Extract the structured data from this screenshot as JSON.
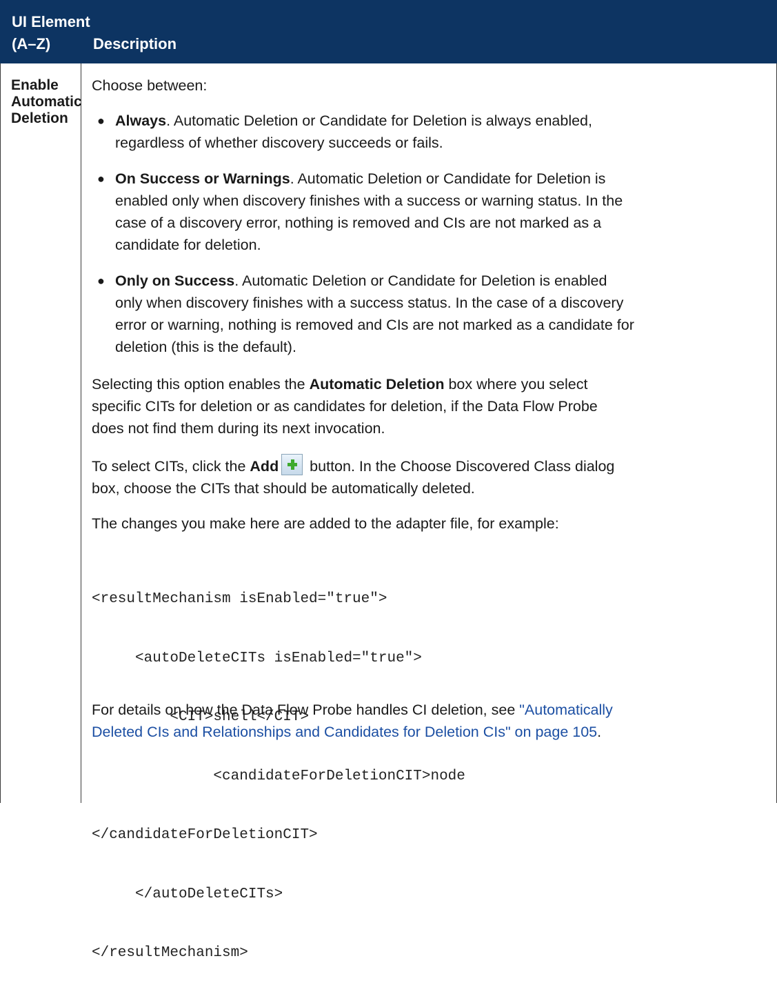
{
  "header": {
    "col1_line1": "UI Element",
    "col1_line2": "(A–Z)",
    "col2": "Description"
  },
  "row": {
    "ui_element_lines": [
      "Enable",
      "Automatic",
      "Deletion"
    ],
    "intro": "Choose between:",
    "bullets": [
      {
        "bold": "Always",
        "lines": [
          ". Automatic Deletion or Candidate for Deletion is always enabled,",
          "regardless of whether discovery succeeds or fails."
        ]
      },
      {
        "bold": "On Success or Warnings",
        "lines": [
          ". Automatic Deletion or Candidate for Deletion is",
          "enabled only when discovery finishes with a success or warning status. In the",
          "case of a discovery error, nothing is removed and CIs are not marked as a",
          "candidate for deletion."
        ]
      },
      {
        "bold": "Only on Success",
        "lines": [
          ". Automatic Deletion or Candidate for Deletion is enabled",
          "only when discovery finishes with a success status. In the case of a discovery",
          "error or warning, nothing is removed and CIs are not marked as a candidate for",
          "deletion (this is the default)."
        ]
      }
    ],
    "select_para": {
      "pre": "Selecting this option enables the ",
      "bold": "Automatic Deletion",
      "post": " box where you select",
      "line2": "specific CITs for deletion or as candidates for deletion, if the Data Flow Probe",
      "line3": "does not find them during its next invocation."
    },
    "add_para": {
      "pre": "To select CITs, click the ",
      "bold": "Add",
      "post": " button. In the Choose Discovered Class dialog",
      "line2": "box, choose the CITs that should be automatically deleted."
    },
    "changes_para": "The changes you make here are added to the adapter file, for example:",
    "code_lines": [
      "<resultMechanism isEnabled=\"true\">",
      "     <autoDeleteCITs isEnabled=\"true\">",
      "         <CIT>shell</CIT>",
      "              <candidateForDeletionCIT>node",
      "</candidateForDeletionCIT>",
      "     </autoDeleteCITs>",
      "</resultMechanism>"
    ],
    "details_para": {
      "pre": "For details on how the Data Flow Probe handles CI deletion, see ",
      "link_line1": "\"Automatically",
      "link_line2": "Deleted CIs and Relationships and Candidates for Deletion CIs\" on page 105",
      "post": "."
    }
  },
  "colors": {
    "header_bg": "#0d3462",
    "link": "#1c4fa3",
    "add_icon": "#3faa2e"
  },
  "icons": {
    "add": "add-plus-icon"
  }
}
